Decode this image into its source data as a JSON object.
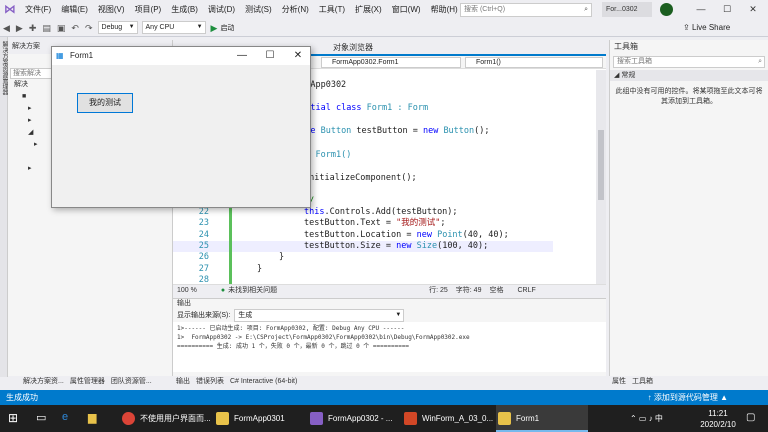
{
  "menu": {
    "items": [
      "文件(F)",
      "编辑(E)",
      "视图(V)",
      "项目(P)",
      "生成(B)",
      "调试(D)",
      "测试(S)",
      "分析(N)",
      "工具(T)",
      "扩展(X)",
      "窗口(W)",
      "帮助(H)"
    ]
  },
  "search": {
    "placeholder": "搜索 (Ctrl+Q)"
  },
  "project_title": "For...0302",
  "toolbar": {
    "config": "Debug",
    "platform": "Any CPU",
    "start": "启动"
  },
  "liveshare": "Live Share",
  "sidestrip": "解决方案资源管理器",
  "solution": {
    "title": "解决方案",
    "search": "搜索解决",
    "items": [
      "解决",
      "■",
      "▸",
      "▸",
      "◢",
      "▸",
      "▸"
    ]
  },
  "tabs": {
    "object_browser": "对象浏览器"
  },
  "nav": {
    "class": "FormApp0302.Form1",
    "member": "Form1()"
  },
  "code": {
    "l1": "ormApp0302",
    "l2a": "partial ",
    "l2b": "class ",
    "l2c": "Form1 : ",
    "l2d": "Form",
    "l3a": "rate ",
    "l3b": "Button ",
    "l3c": "testButton = ",
    "l3d": "new ",
    "l3e": "Button",
    "l3f": "();",
    "l4a": "lic ",
    "l4b": "Form1()",
    "l5": "InitializeComponent();",
    "l21": "//",
    "n22": "22",
    "l22a": "this",
    ".": ".",
    "l22b": ".Controls.Add(testButton);",
    "n23": "23",
    "l23a": "testButton.Text = ",
    "l23b": "\"我的测试\"",
    ";": ";",
    "n24": "24",
    "l24a": "testButton.Location = ",
    "l24b": "new ",
    "l24c": "Point",
    "l24d": "(40, 40);",
    "n25": "25",
    "l25a": "testButton.Size = ",
    "l25b": "new ",
    "l25c": "Size",
    "l25d": "(100, 40);",
    "n26": "26",
    "l26": "}",
    "n27": "27",
    "l27": "}",
    "n28": "28"
  },
  "editor_status": {
    "zoom": "100 %",
    "issues": "未找到相关问题",
    "line": "行: 25",
    "col": "字符: 49",
    "mode": "空格",
    "eol": "CRLF"
  },
  "toolbox": {
    "title": "工具箱",
    "search": "搜索工具箱",
    "group": "常规",
    "message": "此组中没有可用的控件。将某项拖至此文本可将其添加到工具箱。"
  },
  "output": {
    "title": "输出",
    "source_label": "显示输出来源(S):",
    "source": "生成",
    "lines": [
      "1>------ 已启动生成: 项目: FormApp0302, 配置: Debug Any CPU ------",
      "1>  FormApp0302 -> E:\\CSProject\\FormApp0302\\FormApp0302\\bin\\Debug\\FormApp0302.exe",
      "========== 生成: 成功 1 个，失败 0 个，最新 0 个，跳过 0 个 =========="
    ]
  },
  "bottom_left_tabs": [
    "解决方案资...",
    "属性管理器",
    "团队资源管..."
  ],
  "bottom_mid_tabs": [
    "输出",
    "错误列表",
    "C# Interactive (64-bit)"
  ],
  "bottom_right_tabs": [
    "属性",
    "工具箱"
  ],
  "status": {
    "left": "生成成功",
    "right": "↑ 添加到源代码管理 ▲"
  },
  "form1": {
    "title": "Form1",
    "button": "我的测试"
  },
  "taskbar": {
    "items": [
      "不使用用户界面而...",
      "FormApp0301",
      "FormApp0302 - ...",
      "WinForm_A_03_0...",
      "Form1"
    ],
    "time": "11:21",
    "date": "2020/2/10"
  },
  "colors": {
    "accent": "#007acc",
    "vs_purple": "#865fc5",
    "taskbar": "#1f1f1f"
  }
}
